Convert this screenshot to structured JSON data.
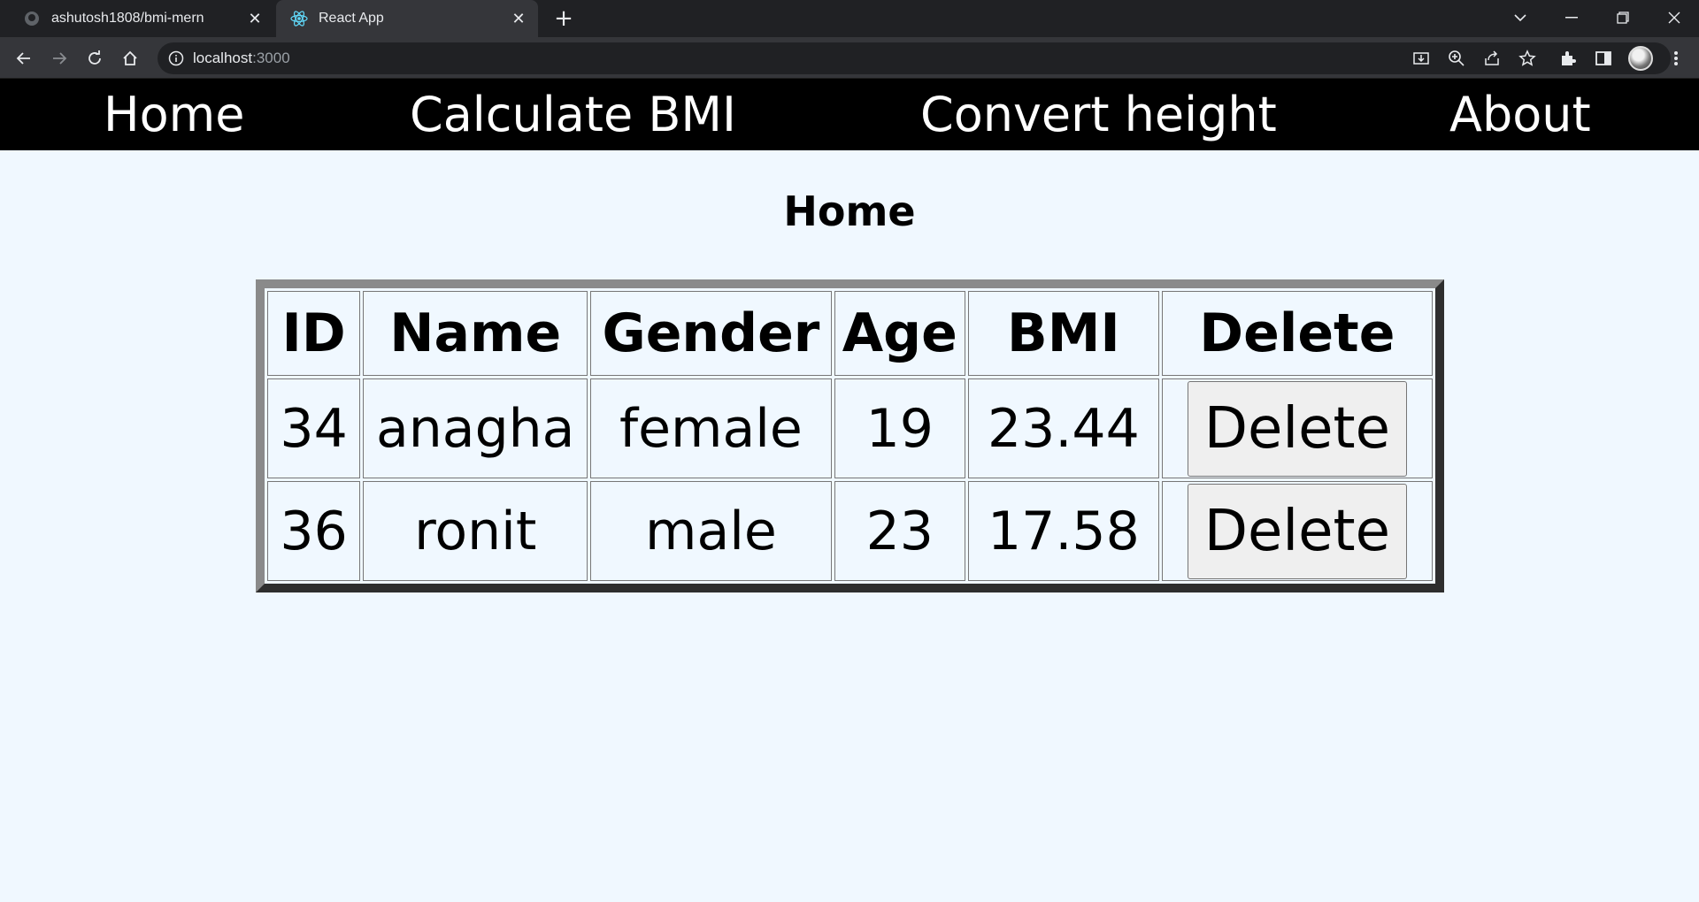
{
  "browser": {
    "tabs": [
      {
        "title": "ashutosh1808/bmi-mern",
        "icon": "github-icon",
        "active": false
      },
      {
        "title": "React App",
        "icon": "react-icon",
        "active": true
      }
    ],
    "new_tab_label": "+",
    "url_host": "localhost",
    "url_port": ":3000"
  },
  "nav": {
    "items": [
      {
        "label": "Home"
      },
      {
        "label": "Calculate BMI"
      },
      {
        "label": "Convert height"
      },
      {
        "label": "About"
      }
    ]
  },
  "page": {
    "title": "Home"
  },
  "table": {
    "headers": [
      "ID",
      "Name",
      "Gender",
      "Age",
      "BMI",
      "Delete"
    ],
    "rows": [
      {
        "id": "34",
        "name": "anagha",
        "gender": "female",
        "age": "19",
        "bmi": "23.44",
        "delete_label": "Delete"
      },
      {
        "id": "36",
        "name": "ronit",
        "gender": "male",
        "age": "23",
        "bmi": "17.58",
        "delete_label": "Delete"
      }
    ]
  },
  "colors": {
    "nav_bg": "#000000",
    "page_bg": "#f0f8ff",
    "chrome_tabbar": "#202124",
    "chrome_toolbar": "#35363a"
  }
}
